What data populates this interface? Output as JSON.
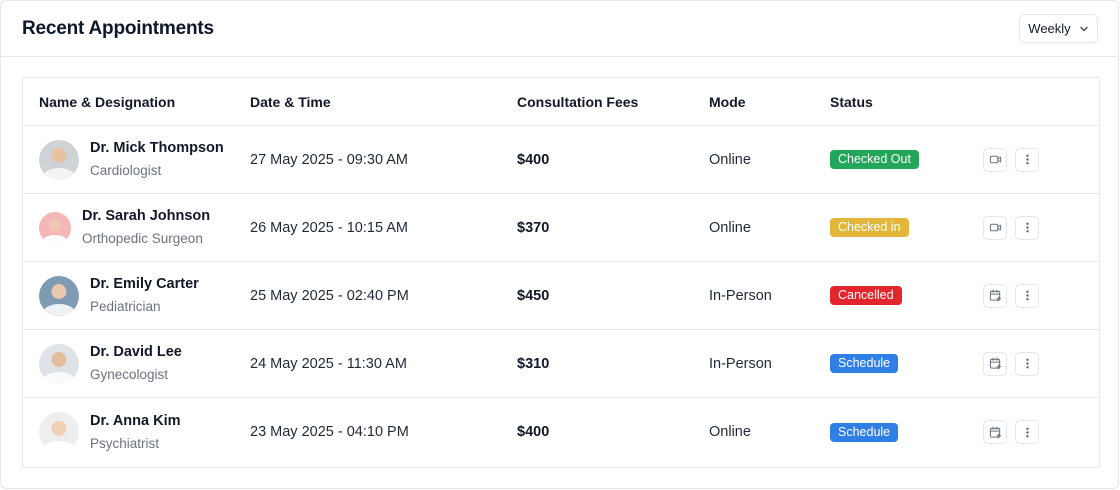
{
  "header": {
    "title": "Recent Appointments",
    "period_label": "Weekly"
  },
  "table": {
    "columns": [
      "Name & Designation",
      "Date & Time",
      "Consultation Fees",
      "Mode",
      "Status"
    ],
    "rows": [
      {
        "name": "Dr. Mick Thompson",
        "role": "Cardiologist",
        "datetime": "27 May 2025 - 09:30 AM",
        "fee": "$400",
        "mode": "Online",
        "status": "Checked Out",
        "status_color": "#22a75a",
        "action_icon": "video-icon",
        "avatar_bg": "#cfd3d8",
        "skin": "#e6c2a3",
        "shirt": "#f3f4f6"
      },
      {
        "name": "Dr. Sarah Johnson",
        "role": "Orthopedic Surgeon",
        "datetime": "26 May 2025 - 10:15 AM",
        "fee": "$370",
        "mode": "Online",
        "status": "Checked in",
        "status_color": "#e1b63a",
        "action_icon": "video-icon",
        "avatar_bg": "#f4b6b6",
        "skin": "#f0c9b4",
        "shirt": "#ffffff"
      },
      {
        "name": "Dr. Emily Carter",
        "role": "Pediatrician",
        "datetime": "25 May 2025 - 02:40 PM",
        "fee": "$450",
        "mode": "In-Person",
        "status": "Cancelled",
        "status_color": "#e3262c",
        "action_icon": "calendar-add-icon",
        "avatar_bg": "#7f9bb3",
        "skin": "#e9c8ae",
        "shirt": "#eef2f6"
      },
      {
        "name": "Dr. David Lee",
        "role": "Gynecologist",
        "datetime": "24 May 2025 - 11:30 AM",
        "fee": "$310",
        "mode": "In-Person",
        "status": "Schedule",
        "status_color": "#2f7fe6",
        "action_icon": "calendar-add-icon",
        "avatar_bg": "#dfe3e8",
        "skin": "#e2bd9e",
        "shirt": "#f8fafc"
      },
      {
        "name": "Dr. Anna Kim",
        "role": "Psychiatrist",
        "datetime": "23 May 2025 - 04:10 PM",
        "fee": "$400",
        "mode": "Online",
        "status": "Schedule",
        "status_color": "#2f7fe6",
        "action_icon": "calendar-add-icon",
        "avatar_bg": "#eeeeee",
        "skin": "#f1d0b6",
        "shirt": "#ffffff"
      }
    ]
  }
}
